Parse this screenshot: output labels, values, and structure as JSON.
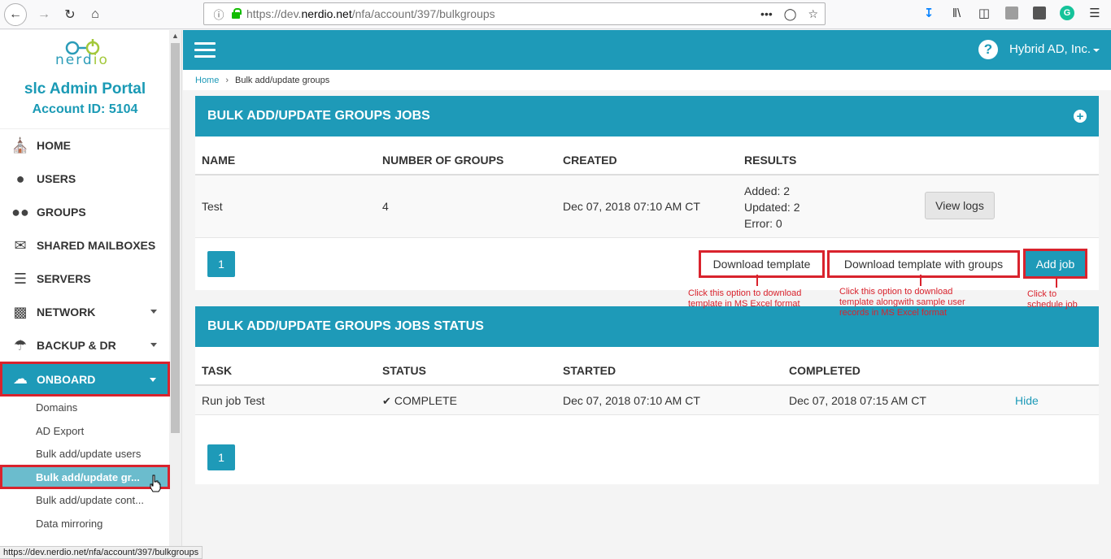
{
  "browser": {
    "url_prefix": "https://dev.",
    "url_domain": "nerdio.net",
    "url_path": "/nfa/account/397/bulkgroups",
    "status_url": "https://dev.nerdio.net/nfa/account/397/bulkgroups"
  },
  "sidebar": {
    "logo_text_a": "nerd",
    "logo_text_b": "io",
    "portal_title": "slc Admin Portal",
    "account_id": "Account ID: 5104",
    "menu": [
      {
        "label": "HOME"
      },
      {
        "label": "USERS"
      },
      {
        "label": "GROUPS"
      },
      {
        "label": "SHARED MAILBOXES"
      },
      {
        "label": "SERVERS"
      },
      {
        "label": "NETWORK"
      },
      {
        "label": "BACKUP & DR"
      },
      {
        "label": "ONBOARD"
      }
    ],
    "submenu": [
      {
        "label": "Domains"
      },
      {
        "label": "AD Export"
      },
      {
        "label": "Bulk add/update users"
      },
      {
        "label": "Bulk add/update gr..."
      },
      {
        "label": "Bulk add/update cont..."
      },
      {
        "label": "Data mirroring"
      }
    ]
  },
  "topbar": {
    "company": "Hybrid AD, Inc."
  },
  "breadcrumb": {
    "home": "Home",
    "separator": "›",
    "current": "Bulk add/update groups"
  },
  "jobs_panel": {
    "title": "BULK ADD/UPDATE GROUPS JOBS",
    "columns": [
      "NAME",
      "NUMBER OF GROUPS",
      "CREATED",
      "RESULTS"
    ],
    "rows": [
      {
        "name": "Test",
        "number_of_groups": "4",
        "created": "Dec 07, 2018 07:10 AM CT",
        "results_added": "Added: 2",
        "results_updated": "Updated: 2",
        "results_error": "Error: 0",
        "action": "View logs"
      }
    ],
    "page": "1",
    "download_template": "Download template",
    "download_template_groups": "Download template with groups",
    "add_job": "Add job"
  },
  "annotations": {
    "download_template_a": "Click this option to download",
    "download_template_b": "template in MS Excel format",
    "download_groups_a": "Click this option to download",
    "download_groups_b": "template alongwith sample user",
    "download_groups_c": "records in MS Excel format",
    "add_job_a": "Click to",
    "add_job_b": "schedule job"
  },
  "status_panel": {
    "title": "BULK ADD/UPDATE GROUPS JOBS STATUS",
    "columns": [
      "TASK",
      "STATUS",
      "STARTED",
      "COMPLETED"
    ],
    "rows": [
      {
        "task": "Run job Test",
        "status": "COMPLETE",
        "started": "Dec 07, 2018 07:10 AM CT",
        "completed": "Dec 07, 2018 07:15 AM CT",
        "action": "Hide"
      }
    ],
    "page": "1"
  }
}
